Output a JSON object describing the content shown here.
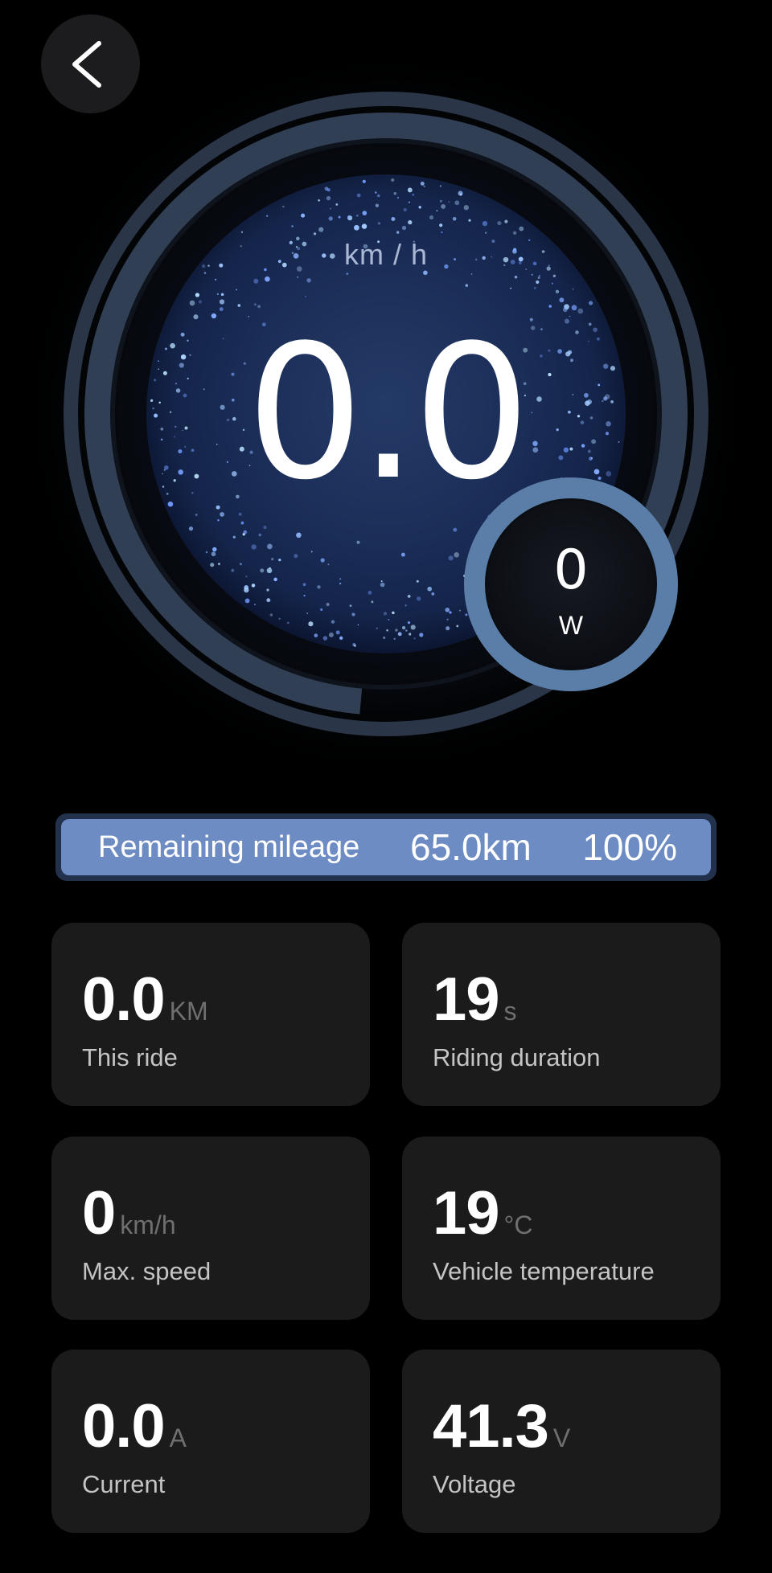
{
  "header": {
    "back_icon": "chevron-left-icon"
  },
  "gauge": {
    "speed_unit": "km / h",
    "speed_value": "0.0",
    "power_value": "0",
    "power_unit": "W"
  },
  "mileage": {
    "label": "Remaining mileage",
    "distance": "65.0km",
    "percent_text": "100%",
    "fill_fraction": 1.0
  },
  "stats": [
    {
      "value": "0.0",
      "unit": "KM",
      "label": "This ride"
    },
    {
      "value": "19",
      "unit": "s",
      "label": "Riding duration"
    },
    {
      "value": "0",
      "unit": "km/h",
      "label": "Max. speed"
    },
    {
      "value": "19",
      "unit": "°C",
      "label": "Vehicle temperature"
    },
    {
      "value": "0.0",
      "unit": "A",
      "label": "Current"
    },
    {
      "value": "41.3",
      "unit": "V",
      "label": "Voltage"
    }
  ],
  "colors": {
    "background": "#000000",
    "card": "#1b1b1b",
    "mileage_fill": "#6d8cc4",
    "gauge_ring": "#2a3648",
    "power_ring": "#5b7ea8"
  }
}
